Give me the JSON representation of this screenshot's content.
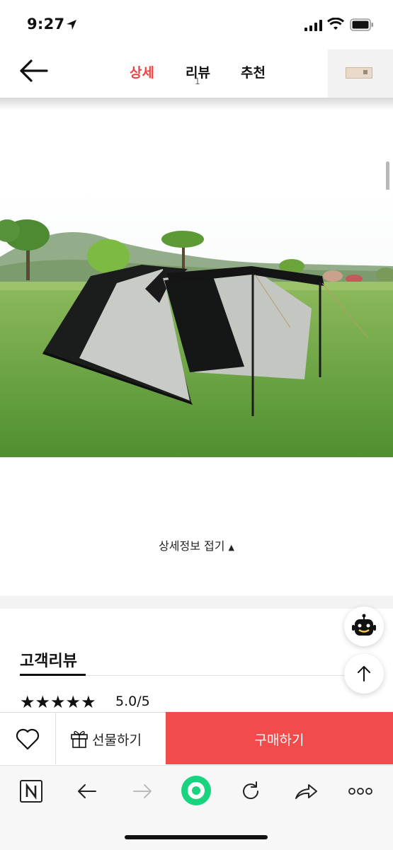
{
  "status_bar": {
    "time": "9:27"
  },
  "header": {
    "tabs": [
      {
        "label": "상세",
        "active": true
      },
      {
        "label": "리뷰",
        "count": "1"
      },
      {
        "label": "추천"
      }
    ]
  },
  "detail": {
    "collapse_label": "상세정보 접기",
    "collapse_arrow": "▲"
  },
  "reviews": {
    "title": "고객리뷰",
    "stars": "★★★★★",
    "rating_text": "5.0/5"
  },
  "purchase_bar": {
    "gift_label": "선물하기",
    "buy_label": "구매하기"
  },
  "icons": {
    "back": "arrow-left-icon",
    "wish": "heart-icon",
    "gift": "gift-icon",
    "bot": "chatbot-icon",
    "scroll_top": "arrow-up-icon",
    "browser": [
      "naver-n-icon",
      "back-arrow-icon",
      "forward-arrow-icon",
      "green-circle-icon",
      "reload-icon",
      "share-icon",
      "more-icon"
    ]
  },
  "colors": {
    "accent": "#f04444",
    "buy_button": "#f24b4b",
    "green_button": "#19d37f"
  }
}
